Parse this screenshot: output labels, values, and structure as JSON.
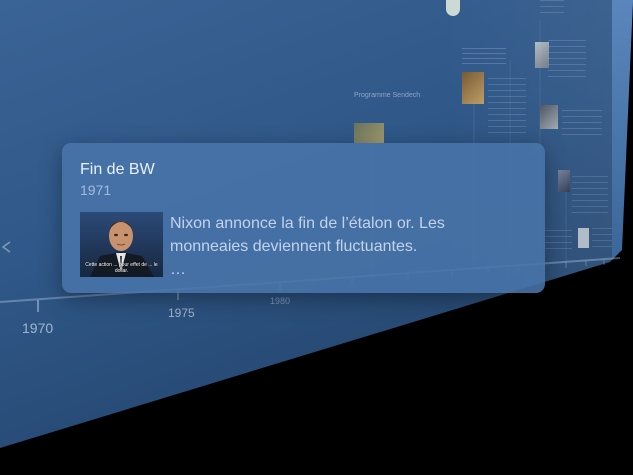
{
  "timeline": {
    "years": [
      "1970",
      "1975",
      "1980"
    ],
    "events": {
      "sendech_label": "Programme Sendech"
    }
  },
  "card": {
    "title": "Fin de BW",
    "year": "1971",
    "description": "Nixon annonce la fin de l’étalon or. Les monneaies deviennent fluctuantes.",
    "ellipsis": "…",
    "photo_caption": "Cette action ... pour effet de ... le dollar."
  },
  "colors": {
    "panel": "#2f5787",
    "card": "#4874aa",
    "background": "#000000"
  }
}
